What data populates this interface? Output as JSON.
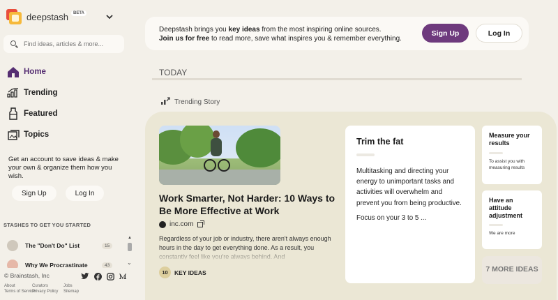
{
  "brand": {
    "name": "deepstash",
    "badge": "BETA"
  },
  "search": {
    "placeholder": "Find ideas, articles & more..."
  },
  "nav": [
    {
      "label": "Home",
      "icon": "home-icon",
      "active": true
    },
    {
      "label": "Trending",
      "icon": "trending-icon"
    },
    {
      "label": "Featured",
      "icon": "featured-icon"
    },
    {
      "label": "Topics",
      "icon": "topics-icon"
    }
  ],
  "sidebar": {
    "promo": "Get an account to save ideas & make your own & organize them how you wish.",
    "signup_label": "Sign Up",
    "login_label": "Log In",
    "stashes_heading": "STASHES TO GET YOU STARTED",
    "stashes": [
      {
        "label": "The \"Don't Do\" List",
        "count": "15"
      },
      {
        "label": "Why We Procrastinate",
        "count": "43"
      }
    ]
  },
  "footer": {
    "copyright": "© Brainstash, Inc",
    "socials": [
      "twitter-icon",
      "facebook-icon",
      "instagram-icon",
      "medium-icon"
    ],
    "links": [
      "About",
      "Curators",
      "Jobs",
      "Terms of Service",
      "Privacy Policy",
      "Sitemap"
    ]
  },
  "banner": {
    "line1_a": "Deepstash brings you ",
    "line1_b": "key ideas",
    "line1_c": " from the most inspiring online sources.",
    "line2_a": "Join us for free",
    "line2_b": " to read more, save what inspires you & remember everything.",
    "signup_label": "Sign Up",
    "login_label": "Log In"
  },
  "feed": {
    "section": "TODAY",
    "trending_label": "Trending Story",
    "story": {
      "title": "Work Smarter, Not Harder: 10 Ways to Be More Effective at Work",
      "source": "inc.com",
      "description": "Regardless of your job or industry, there aren't always enough hours in the day to get everything done. As a result, you constantly feel like you're always behind. And",
      "key_ideas_count": "10",
      "key_ideas_label": "KEY IDEAS"
    },
    "idea": {
      "title": "Trim the fat",
      "body": "Multitasking and directing your energy to unimportant tasks and activities will overwhelm and prevent you from being productive.",
      "foot": "Focus on your 3 to 5 ..."
    },
    "mini_ideas": [
      {
        "title": "Measure your results",
        "body": "To assist you with measuring results"
      },
      {
        "title": "Have an attitude adjustment",
        "body": "We are more"
      }
    ],
    "more_ideas": "7 MORE IDEAS"
  },
  "colors": {
    "accent": "#6e3a7d",
    "background": "#f3f0e9",
    "panel": "#ebe7d5"
  }
}
